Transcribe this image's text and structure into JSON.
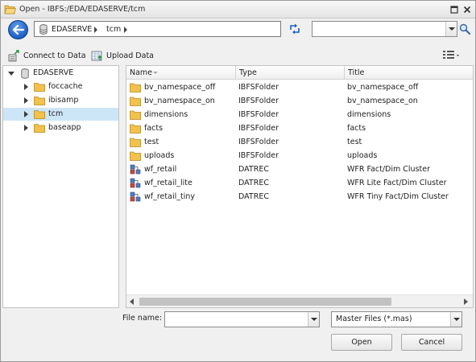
{
  "window": {
    "title": "Open - IBFS:/EDA/EDASERVE/tcm"
  },
  "address": {
    "crumbs": [
      "EDASERVE",
      "tcm"
    ],
    "search_value": ""
  },
  "toolbar": {
    "connect_label": "Connect to Data",
    "upload_label": "Upload Data"
  },
  "tree": {
    "root": "EDASERVE",
    "items": [
      {
        "label": "foccache",
        "selected": false
      },
      {
        "label": "ibisamp",
        "selected": false
      },
      {
        "label": "tcm",
        "selected": true
      },
      {
        "label": "baseapp",
        "selected": false
      }
    ]
  },
  "list": {
    "columns": [
      "Name",
      "Type",
      "Title"
    ],
    "rows": [
      {
        "name": "bv_namespace_off",
        "type": "IBFSFolder",
        "title": "bv_namespace_off",
        "icon": "folder-icon"
      },
      {
        "name": "bv_namespace_on",
        "type": "IBFSFolder",
        "title": "bv_namespace_on",
        "icon": "folder-icon"
      },
      {
        "name": "dimensions",
        "type": "IBFSFolder",
        "title": "dimensions",
        "icon": "folder-icon"
      },
      {
        "name": "facts",
        "type": "IBFSFolder",
        "title": "facts",
        "icon": "folder-icon"
      },
      {
        "name": "test",
        "type": "IBFSFolder",
        "title": "test",
        "icon": "folder-icon"
      },
      {
        "name": "uploads",
        "type": "IBFSFolder",
        "title": "uploads",
        "icon": "folder-icon"
      },
      {
        "name": "wf_retail",
        "type": "DATREC",
        "title": "WFR Fact/Dim Cluster",
        "icon": "cluster-icon"
      },
      {
        "name": "wf_retail_lite",
        "type": "DATREC",
        "title": "WFR Lite Fact/Dim Cluster",
        "icon": "cluster-icon"
      },
      {
        "name": "wf_retail_tiny",
        "type": "DATREC",
        "title": "WFR Tiny Fact/Dim Cluster",
        "icon": "cluster-icon"
      }
    ]
  },
  "footer": {
    "file_name_label": "File name:",
    "file_name_value": "",
    "file_type": "Master Files (*.mas)",
    "open_label": "Open",
    "cancel_label": "Cancel"
  },
  "colors": {
    "selection": "#cde6f7",
    "folder": "#f2c14e",
    "accent": "#1a5fc4"
  }
}
